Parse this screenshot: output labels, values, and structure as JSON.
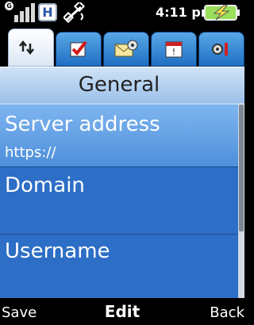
{
  "status": {
    "network_letter": "H",
    "gprs_badge": "G",
    "time": "4:11 pm",
    "icons": [
      "signal-icon",
      "hsdpa-icon",
      "satellite-icon",
      "battery-charging-icon"
    ]
  },
  "tabs": [
    {
      "icon": "sync-icon"
    },
    {
      "icon": "checkmark-icon"
    },
    {
      "icon": "email-settings-icon"
    },
    {
      "icon": "calendar-icon"
    },
    {
      "icon": "settings-icon"
    }
  ],
  "title": "General",
  "items": [
    {
      "label": "Server address",
      "value": "https://"
    },
    {
      "label": "Domain",
      "value": ""
    },
    {
      "label": "Username",
      "value": ""
    }
  ],
  "softkeys": {
    "left": "Save",
    "center": "Edit",
    "right": "Back"
  },
  "colors": {
    "accent": "#2d6ec6",
    "selected": "#6aa4e8",
    "title_bg": "#b8d4f2"
  }
}
